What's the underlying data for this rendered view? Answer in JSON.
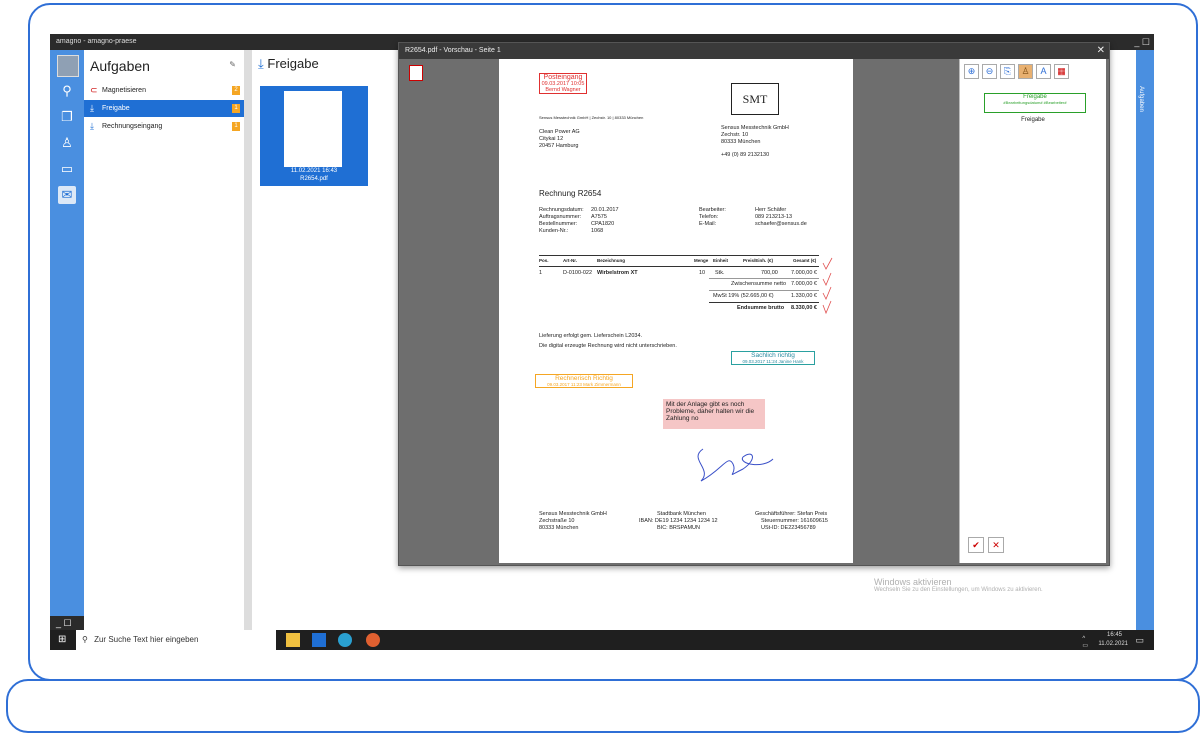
{
  "window": {
    "title": "amagno - amagno-praese",
    "controls": "_ ☐"
  },
  "leftbar": {
    "icons": [
      "avatar",
      "search-icon",
      "documents-icon",
      "user-icon",
      "chat-icon",
      "inbox-tasks-icon"
    ],
    "bottom": "_ ☐"
  },
  "aufgaben": {
    "title": "Aufgaben",
    "items": [
      {
        "label": "Magnetisieren",
        "badge": "2"
      },
      {
        "label": "Freigabe",
        "badge": "1"
      },
      {
        "label": "Rechnungseingang",
        "badge": "1"
      }
    ]
  },
  "freigabe": {
    "title": "Freigabe",
    "thumb": {
      "date": "11.02.2021 16:43",
      "name": "R2654.pdf"
    }
  },
  "preview": {
    "title": "R2654.pdf - Vorschau - Seite 1",
    "doc": {
      "posteingang": {
        "title": "Posteingang",
        "date": "09.03.2017 10:05",
        "name": "Bernd Wagner"
      },
      "sender_line": "Sensus Messtechnik GmbH | Zechstr. 10 | 80333 München",
      "recipient": [
        "Clean Power AG",
        "Citykai 12",
        "20457 Hamburg"
      ],
      "logo": "SMT",
      "company": [
        "Sensus Messtechnik GmbH",
        "Zechstr. 10",
        "80333 München",
        "",
        "+49 (0) 89 2132130"
      ],
      "heading": "Rechnung R2654",
      "meta_left_labels": [
        "Rechnungsdatum:",
        "Auftragsnummer:",
        "Bestellnummer:",
        "Kunden-Nr.:"
      ],
      "meta_left_values": [
        "20.01.2017",
        "A7575",
        "CPA1820",
        "1068"
      ],
      "meta_right_labels": [
        "Bearbeiter:",
        "Telefon:",
        "E-Mail:"
      ],
      "meta_right_values": [
        "Herr Schäfer",
        "089 213213-13",
        "schaefer@sensus.de"
      ],
      "table_headers": [
        "Pos.",
        "Art-Nr.",
        "Bezeichnung",
        "Menge",
        "Einheit",
        "Preis/Einh. (€)",
        "Gesamt (€)"
      ],
      "row": [
        "1",
        "D-0100-022",
        "Wirbelstrom XT",
        "10",
        "Stk.",
        "700,00",
        "7.000,00 €"
      ],
      "zwischensumme": {
        "label": "Zwischensumme netto",
        "value": "7.000,00 €"
      },
      "mwst": {
        "label": "MwSt 19% (52.665,00 €)",
        "value": "1.330,00 €"
      },
      "endsumme": {
        "label": "Endsumme brutto",
        "value": "8.330,00 €"
      },
      "lieferung": "Lieferung erfolgt gem. Lieferschein L2034.",
      "digital": "Die digital erzeugte Rechnung wird nicht unterschrieben.",
      "sachlich": {
        "title": "Sachlich richtig",
        "date": "09.03.2017 11:24 Janine Hank"
      },
      "rechnerisch": {
        "title": "Rechnerisch Richtig",
        "date": "09.03.2017 11:23 Mark Zimmermann"
      },
      "note": "Mit der Anlage gibt es noch Probleme, daher halten wir die Zahlung no",
      "footer_left": [
        "Sensus Messtechnik GmbH",
        "Zechstraße 10",
        "80333 München"
      ],
      "footer_mid": [
        "Stadtbank München",
        "IBAN: DE19 1234 1234 1234 12",
        "BIC: BRSPAMUN"
      ],
      "footer_right": [
        "Geschäftsführer: Stefan Preis",
        "Steuernummer: 161609615",
        "USt-ID: DE223456789"
      ]
    },
    "side": {
      "stamp_title": "Freigabe",
      "stamp_sub": "#Bearbeitungsdatum# #Bearbeiter#",
      "label": "Freigabe"
    }
  },
  "taskbar": {
    "search_placeholder": "Zur Suche Text hier eingeben",
    "time": "16:45",
    "date": "11.02.2021"
  },
  "windows_activation": {
    "title": "Windows aktivieren",
    "sub": "Wechseln Sie zu den Einstellungen, um Windows zu aktivieren."
  },
  "rightstrip": {
    "label": "Aufgaben"
  }
}
